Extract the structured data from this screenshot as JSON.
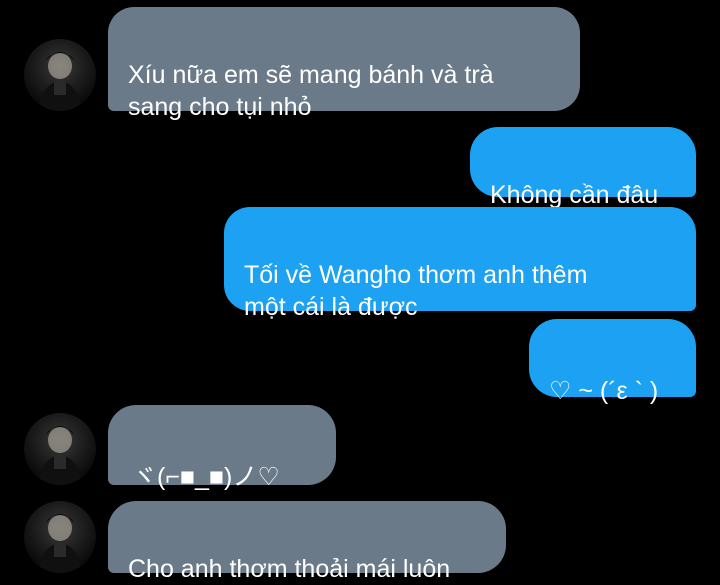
{
  "chat": {
    "messages": [
      {
        "sender": "other",
        "text": "Xíu nữa em sẽ mang bánh và trà\nsang cho tụi nhỏ"
      },
      {
        "sender": "me",
        "text": "Không cần đâu"
      },
      {
        "sender": "me",
        "text": "Tối về Wangho thơm anh thêm\nmột cái là được"
      },
      {
        "sender": "me",
        "text": "♡ ~ (´ε ` )"
      },
      {
        "sender": "other",
        "text": "ヾ(⌐■_■)ノ♡"
      },
      {
        "sender": "other",
        "text": "Cho anh thơm thoải mái luôn"
      }
    ]
  },
  "colors": {
    "background": "#000000",
    "incoming_bubble": "#6b7a89",
    "outgoing_bubble": "#1da1f2",
    "text": "#ffffff"
  },
  "icons": {
    "avatar": "profile-photo-dark"
  }
}
